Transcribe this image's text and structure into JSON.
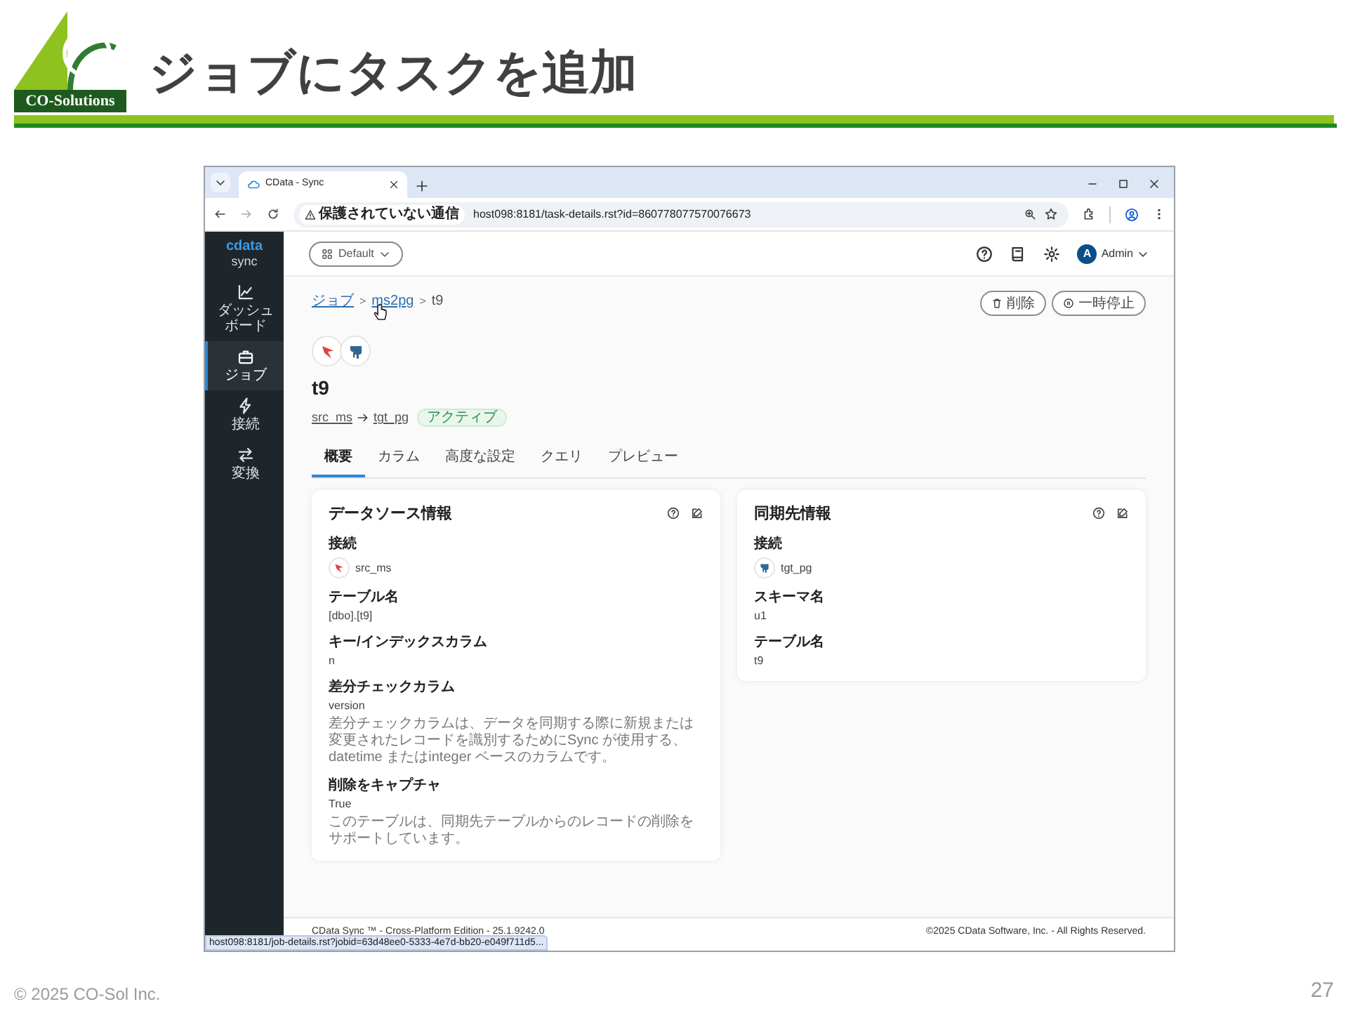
{
  "slide": {
    "logo_text": "CO-Solutions",
    "title": "ジョブにタスクを追加",
    "footer": "© 2025 CO-Sol Inc.",
    "page_number": "27"
  },
  "browser": {
    "tab_title": "CData - Sync",
    "security_label": "保護されていない通信",
    "url": "host098:8181/task-details.rst?id=860778077570076673",
    "status_url": "host098:8181/job-details.rst?jobid=63d48ee0-5333-4e7d-bb20-e049f711d5..."
  },
  "app": {
    "brand": "cdata",
    "brand_sub": "sync",
    "workspace": "Default",
    "user_initial": "A",
    "user_name": "Admin",
    "sidebar": [
      {
        "label": "ダッシュボード",
        "selected": false
      },
      {
        "label": "ジョブ",
        "selected": true
      },
      {
        "label": "接続",
        "selected": false
      },
      {
        "label": "変換",
        "selected": false
      }
    ],
    "breadcrumbs": [
      {
        "label": "ジョブ",
        "kind": "link",
        "separator": ">"
      },
      {
        "label": "ms2pg",
        "kind": "link",
        "separator": ">"
      },
      {
        "label": "t9",
        "kind": "current"
      }
    ],
    "actions": [
      {
        "label": "削除",
        "kind": "delete"
      },
      {
        "label": "一時停止",
        "kind": "pause"
      }
    ],
    "task_title": "t9",
    "source": "src_ms",
    "target": "tgt_pg",
    "status": "アクティブ",
    "tabs": [
      {
        "label": "概要",
        "selected": true
      },
      {
        "label": "カラム",
        "selected": false
      },
      {
        "label": "高度な設定",
        "selected": false
      },
      {
        "label": "クエリ",
        "selected": false
      },
      {
        "label": "プレビュー",
        "selected": false
      }
    ],
    "cards": [
      {
        "title": "データソース情報",
        "kind": "source",
        "fields": [
          {
            "label": "接続",
            "value": "src_ms",
            "kind": "connection"
          },
          {
            "label": "テーブル名",
            "value": "[dbo].[t9]",
            "kind": "text"
          },
          {
            "label": "キー/インデックスカラム",
            "value": "n",
            "kind": "text"
          },
          {
            "label": "差分チェックカラム",
            "value": "version",
            "kind": "text",
            "description": "差分チェックカラムは、データを同期する際に新規または変更されたレコードを識別するためにSync が使用する、datetime またはinteger ベースのカラムです。"
          },
          {
            "label": "削除をキャプチャ",
            "value": "True",
            "kind": "text",
            "description": "このテーブルは、同期先テーブルからのレコードの削除をサポートしています。"
          }
        ]
      },
      {
        "title": "同期先情報",
        "kind": "target",
        "fields": [
          {
            "label": "接続",
            "value": "tgt_pg",
            "kind": "connection"
          },
          {
            "label": "スキーマ名",
            "value": "u1",
            "kind": "text"
          },
          {
            "label": "テーブル名",
            "value": "t9",
            "kind": "text"
          }
        ]
      }
    ],
    "footer_version": "CData Sync ™ - Cross-Platform Edition - 25.1.9242.0",
    "footer_copyright": "©2025 CData Software, Inc. - All Rights Reserved."
  }
}
